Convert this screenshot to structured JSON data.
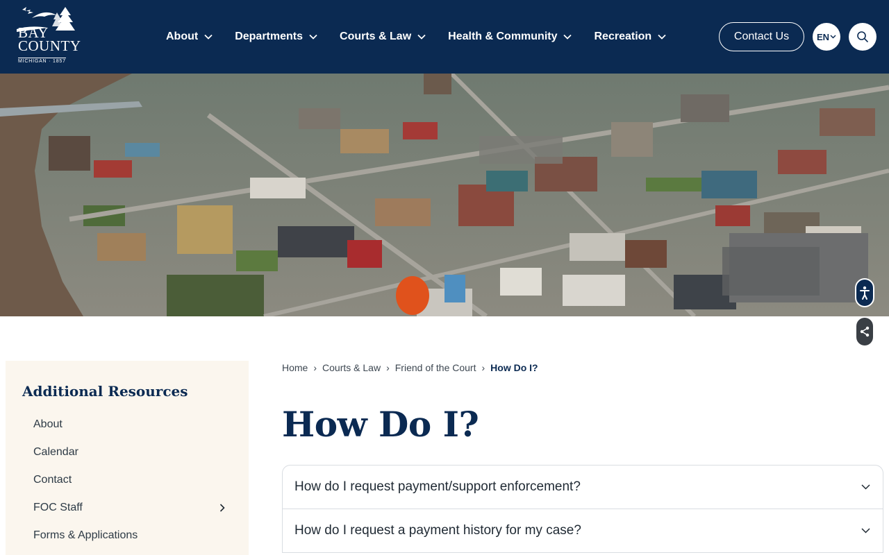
{
  "header": {
    "logo": {
      "line1": "BAY",
      "line2": "COUNTY",
      "tagline": "MICHIGAN · 1857"
    },
    "nav": [
      {
        "label": "About"
      },
      {
        "label": "Departments"
      },
      {
        "label": "Courts & Law"
      },
      {
        "label": "Health & Community"
      },
      {
        "label": "Recreation"
      }
    ],
    "contact_label": "Contact Us",
    "language_label": "EN",
    "search_icon": "search-icon"
  },
  "hero": {
    "description_icon": "aerial-city-photo"
  },
  "floating": {
    "accessibility_icon": "accessibility-icon",
    "share_icon": "share-icon"
  },
  "sidebar": {
    "title": "Additional Resources",
    "items": [
      {
        "label": "About"
      },
      {
        "label": "Calendar"
      },
      {
        "label": "Contact"
      },
      {
        "label": "FOC Staff",
        "has_children": true
      },
      {
        "label": "Forms & Applications"
      }
    ]
  },
  "breadcrumb": {
    "items": [
      "Home",
      "Courts & Law",
      "Friend of the Court"
    ],
    "current": "How Do I?"
  },
  "main": {
    "title": "How Do I?",
    "faqs": [
      {
        "question": "How do I request payment/support enforcement?"
      },
      {
        "question": "How do I request a payment history for my case?"
      }
    ]
  },
  "colors": {
    "navy": "#0b2a52",
    "sidebar_bg": "#fbf6ee",
    "border": "#d9dde2"
  }
}
